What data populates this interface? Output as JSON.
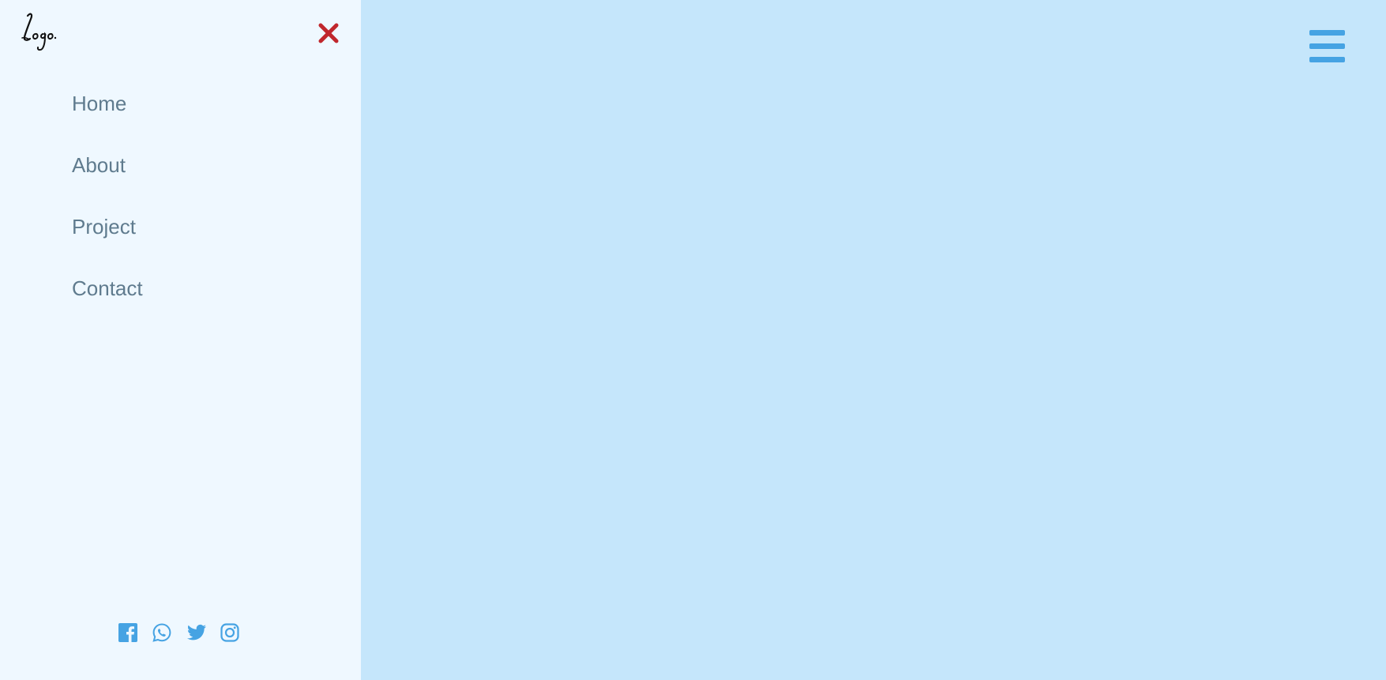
{
  "logo": {
    "text": "Logo"
  },
  "sidebar": {
    "close_icon": "close-icon",
    "nav": [
      {
        "label": "Home"
      },
      {
        "label": "About"
      },
      {
        "label": "Project"
      },
      {
        "label": "Contact"
      }
    ],
    "social": [
      {
        "icon": "facebook-icon"
      },
      {
        "icon": "whatsapp-icon"
      },
      {
        "icon": "twitter-icon"
      },
      {
        "icon": "instagram-icon"
      }
    ]
  },
  "header": {
    "menu_icon": "hamburger-menu-icon"
  },
  "colors": {
    "sidebar_bg": "#eff8ff",
    "main_bg": "#c5e6fb",
    "nav_text": "#5f7b8e",
    "close": "#c0272d",
    "accent": "#46a3e3"
  }
}
